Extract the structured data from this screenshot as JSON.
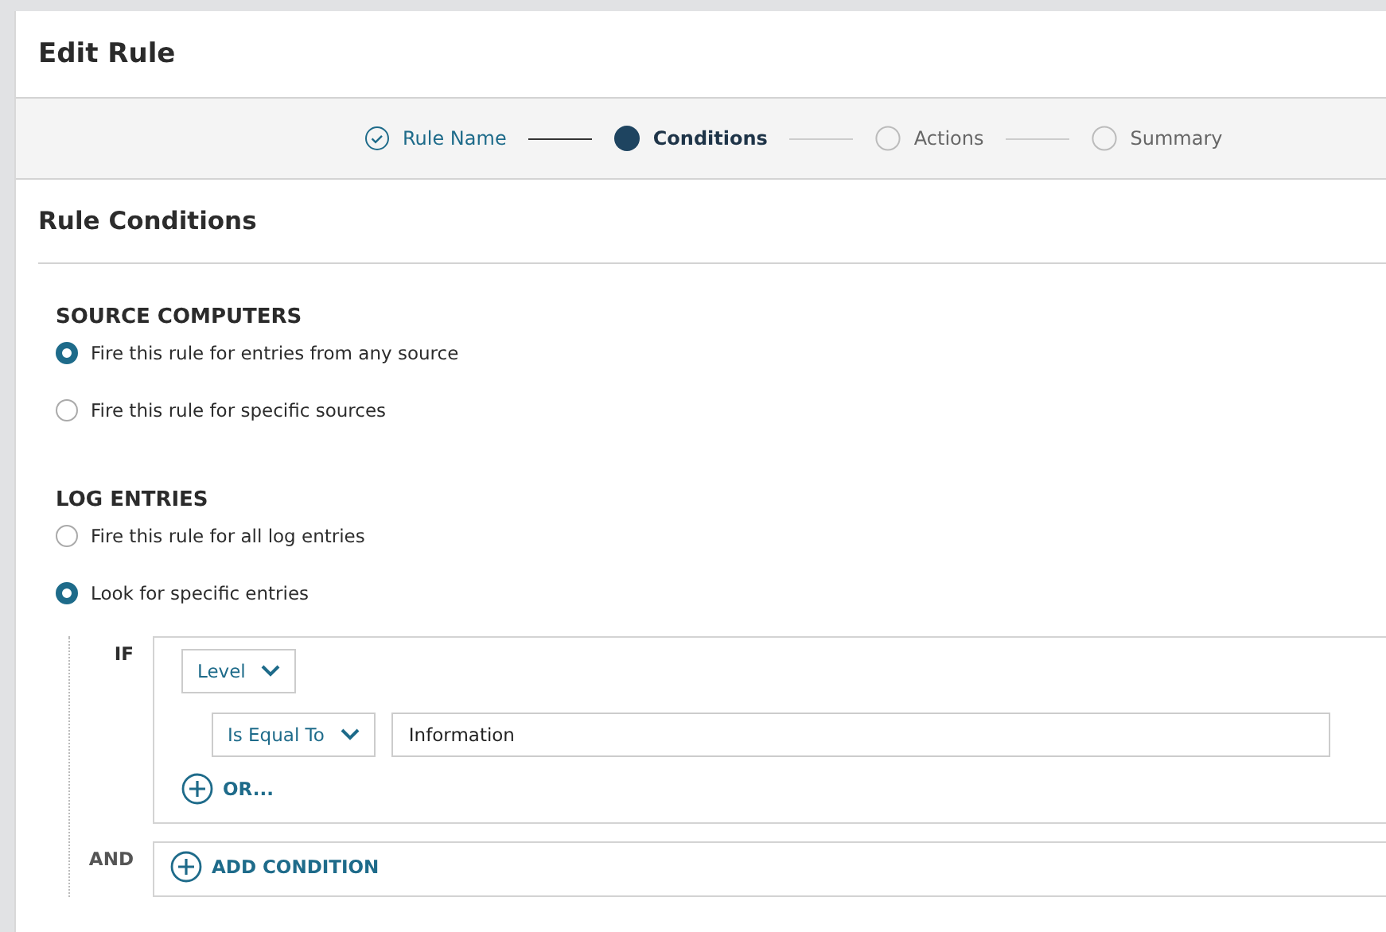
{
  "title": "Edit Rule",
  "steps": [
    {
      "label": "Rule Name",
      "completed": true,
      "selected": false
    },
    {
      "label": "Conditions",
      "completed": false,
      "selected": true
    },
    {
      "label": "Actions",
      "completed": false,
      "selected": false
    },
    {
      "label": "Summary",
      "completed": false,
      "selected": false
    }
  ],
  "section_title": "Rule Conditions",
  "groups": [
    {
      "heading": "SOURCE COMPUTERS",
      "options": [
        {
          "label": "Fire this rule for entries from any source",
          "selected": true
        },
        {
          "label": "Fire this rule for specific sources",
          "selected": false
        }
      ]
    },
    {
      "heading": "LOG ENTRIES",
      "options": [
        {
          "label": "Fire this rule for all log entries",
          "selected": false
        },
        {
          "label": "Look for specific entries",
          "selected": true
        }
      ]
    }
  ],
  "condition": {
    "if_label": "IF",
    "field": "Level",
    "operator": "Is Equal To",
    "value": "Information",
    "or_button": "OR...",
    "and_label": "AND",
    "add_button": "ADD CONDITION"
  }
}
